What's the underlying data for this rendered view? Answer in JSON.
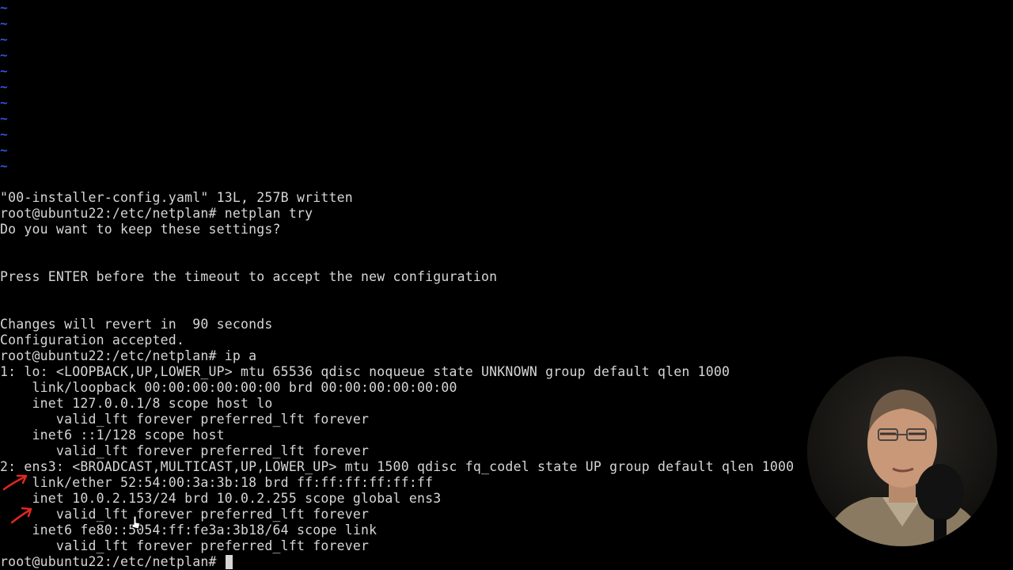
{
  "terminal": {
    "empty_line_marker": "~",
    "lines": [
      "\"00-installer-config.yaml\" 13L, 257B written",
      "root@ubuntu22:/etc/netplan# netplan try",
      "Do you want to keep these settings?",
      "",
      "",
      "Press ENTER before the timeout to accept the new configuration",
      "",
      "",
      "Changes will revert in  90 seconds",
      "Configuration accepted.",
      "root@ubuntu22:/etc/netplan# ip a",
      "1: lo: <LOOPBACK,UP,LOWER_UP> mtu 65536 qdisc noqueue state UNKNOWN group default qlen 1000",
      "    link/loopback 00:00:00:00:00:00 brd 00:00:00:00:00:00",
      "    inet 127.0.0.1/8 scope host lo",
      "       valid_lft forever preferred_lft forever",
      "    inet6 ::1/128 scope host",
      "       valid_lft forever preferred_lft forever",
      "2: ens3: <BROADCAST,MULTICAST,UP,LOWER_UP> mtu 1500 qdisc fq_codel state UP group default qlen 1000",
      "    link/ether 52:54:00:3a:3b:18 brd ff:ff:ff:ff:ff:ff",
      "    inet 10.0.2.153/24 brd 10.0.2.255 scope global ens3",
      "       valid_lft forever preferred_lft forever",
      "    inet6 fe80::5054:ff:fe3a:3b18/64 scope link",
      "       valid_lft forever preferred_lft forever",
      "root@ubuntu22:/etc/netplan# "
    ]
  },
  "colors": {
    "background": "#000000",
    "text": "#d6d6d6",
    "tilde": "#2d57d8",
    "annotation_arrow": "#e0281e"
  },
  "overlays": {
    "annotation_arrows": [
      "red-arrow",
      "red-arrow"
    ],
    "pointer": "mouse-pointer-icon",
    "webcam": "presenter-webcam"
  }
}
